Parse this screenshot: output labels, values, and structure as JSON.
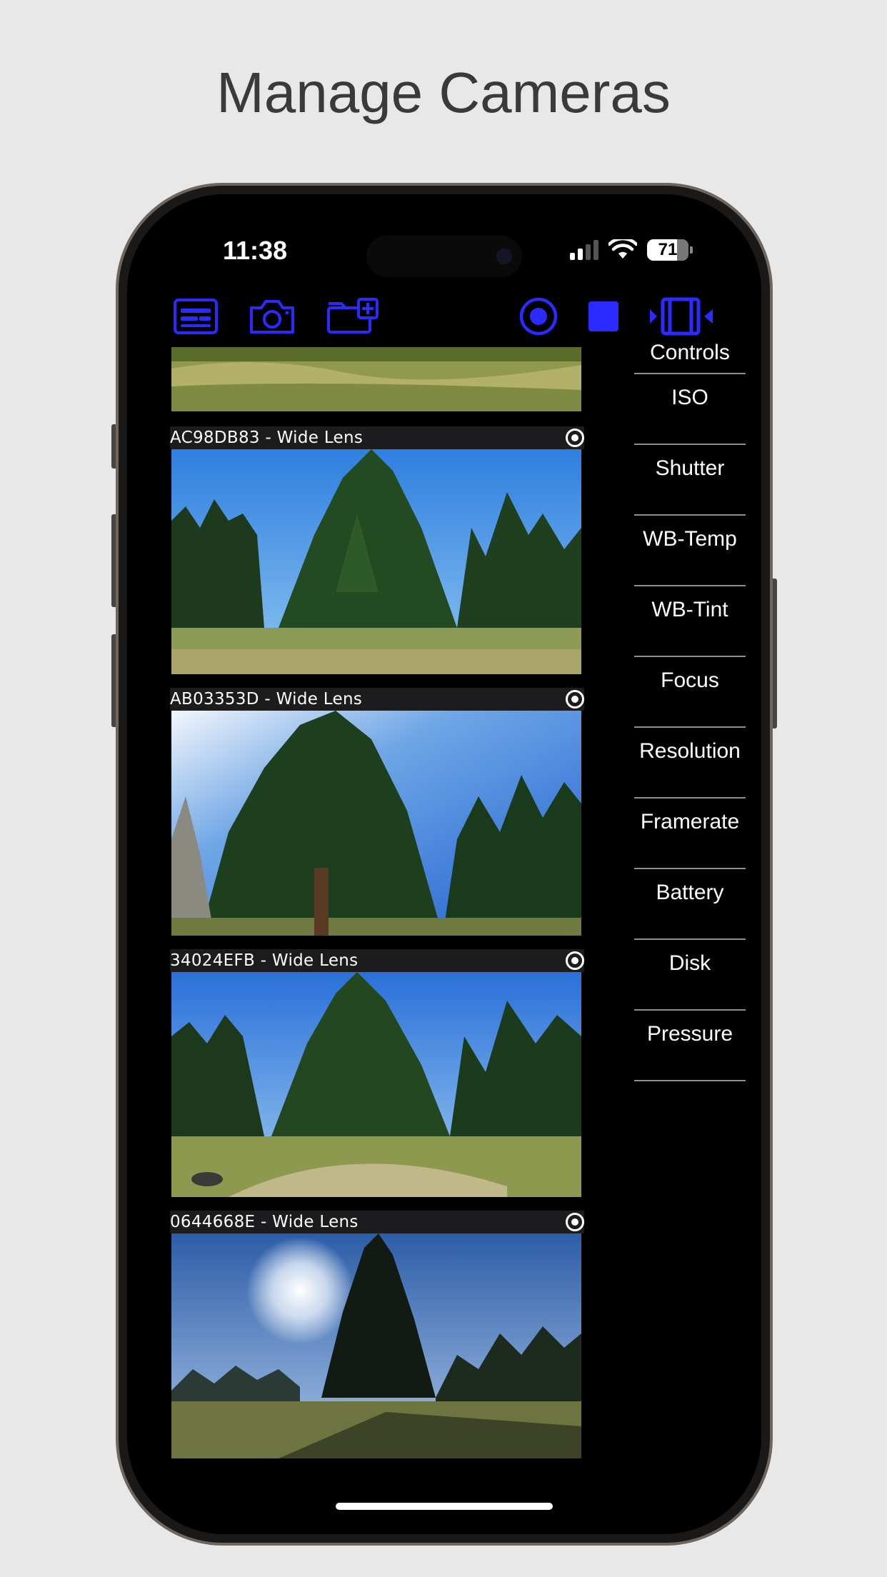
{
  "headline": "Manage Cameras",
  "status": {
    "time": "11:38",
    "battery": "71"
  },
  "toolbar": {
    "accent": "#2b2bff",
    "icons": [
      "list-panel-icon",
      "camera-icon",
      "add-folder-icon",
      "record-icon",
      "stop-icon",
      "controls-panel-icon"
    ]
  },
  "feeds": [
    {
      "label": "AC98DB83 - Wide Lens"
    },
    {
      "label": "AB03353D - Wide Lens"
    },
    {
      "label": "34024EFB - Wide Lens"
    },
    {
      "label": "0644668E - Wide Lens"
    }
  ],
  "controls": {
    "title": "Controls",
    "items": [
      "ISO",
      "Shutter",
      "WB-Temp",
      "WB-Tint",
      "Focus",
      "Resolution",
      "Framerate",
      "Battery",
      "Disk",
      "Pressure"
    ]
  }
}
